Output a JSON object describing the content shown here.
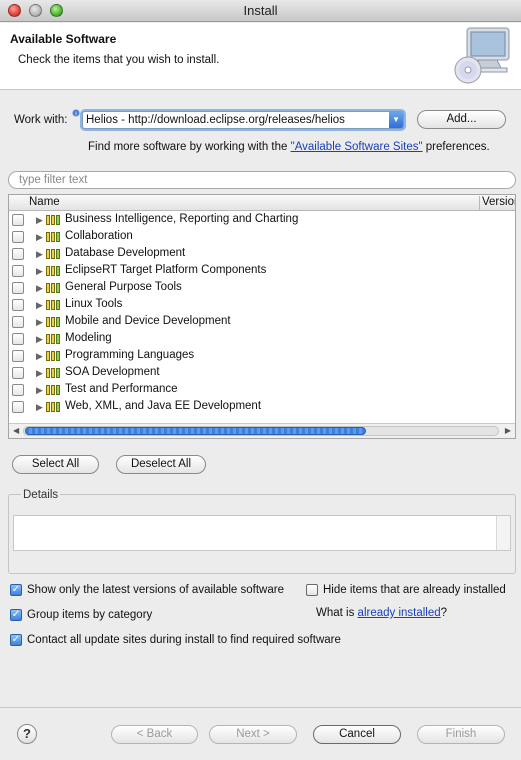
{
  "window": {
    "title": "Install"
  },
  "banner": {
    "title": "Available Software",
    "message": "Check the items that you wish to install.",
    "icon": "monitor-cd-icon"
  },
  "work_with": {
    "label": "Work with:",
    "value": "Helios - http://download.eclipse.org/releases/helios",
    "add_button": "Add...",
    "hint_before": "Find more software by working with the ",
    "hint_link": "\"Available Software Sites\"",
    "hint_after": " preferences."
  },
  "filter": {
    "placeholder": "type filter text"
  },
  "tree": {
    "columns": [
      "Name",
      "Version"
    ],
    "items": [
      {
        "label": "Business Intelligence, Reporting and Charting",
        "checked": false
      },
      {
        "label": "Collaboration",
        "checked": false
      },
      {
        "label": "Database Development",
        "checked": false
      },
      {
        "label": "EclipseRT Target Platform Components",
        "checked": false
      },
      {
        "label": "General Purpose Tools",
        "checked": false
      },
      {
        "label": "Linux Tools",
        "checked": false
      },
      {
        "label": "Mobile and Device Development",
        "checked": false
      },
      {
        "label": "Modeling",
        "checked": false
      },
      {
        "label": "Programming Languages",
        "checked": false
      },
      {
        "label": "SOA Development",
        "checked": false
      },
      {
        "label": "Test and Performance",
        "checked": false
      },
      {
        "label": "Web, XML, and Java EE Development",
        "checked": false
      }
    ],
    "scroll_fraction": 0.72
  },
  "selection_buttons": {
    "select_all": "Select All",
    "deselect_all": "Deselect All"
  },
  "details": {
    "title": "Details",
    "text": ""
  },
  "options": {
    "show_latest": {
      "label": "Show only the latest versions of available software",
      "checked": true
    },
    "hide_installed": {
      "label": "Hide items that are already installed",
      "checked": false
    },
    "group_by_category": {
      "label": "Group items by category",
      "checked": true
    },
    "what_is_before": "What is ",
    "what_is_link": "already installed",
    "what_is_after": "?",
    "contact_all": {
      "label": "Contact all update sites during install to find required software",
      "checked": true
    }
  },
  "footer": {
    "help": "?",
    "back": "< Back",
    "next": "Next >",
    "cancel": "Cancel",
    "finish": "Finish"
  }
}
